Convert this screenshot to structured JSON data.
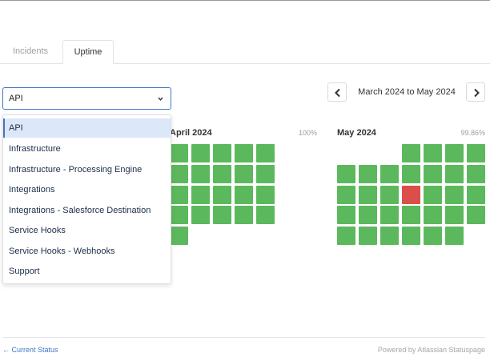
{
  "tabs": [
    {
      "label": "Incidents"
    },
    {
      "label": "Uptime"
    }
  ],
  "component_select": {
    "value": "API",
    "options": [
      "API",
      "Infrastructure",
      "Infrastructure - Processing Engine",
      "Integrations",
      "Integrations - Salesforce Destination",
      "Service Hooks",
      "Service Hooks - Webhooks",
      "Support"
    ]
  },
  "date_nav": {
    "range_label": "March 2024 to May 2024",
    "prev_icon": "chevron-left-icon",
    "next_icon": "chevron-right-icon"
  },
  "months": [
    {
      "name": "April 2024",
      "uptime": "100%",
      "first_weekday": 1,
      "days": 30,
      "outage_days": []
    },
    {
      "name": "May 2024",
      "uptime": "99.86%",
      "first_weekday": 3,
      "days": 31,
      "outage_days": [
        15
      ]
    }
  ],
  "colors": {
    "operational": "#5cb85c",
    "outage": "#db4f4a",
    "accent": "#3e77c8"
  },
  "footer": {
    "current_status": "← Current Status",
    "powered_by": "Powered by Atlassian Statuspage"
  }
}
